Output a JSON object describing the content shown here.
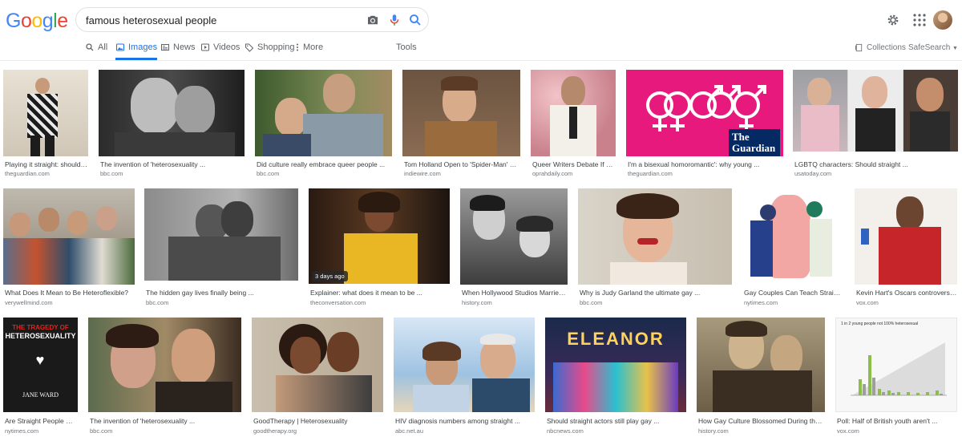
{
  "logo": [
    "G",
    "o",
    "o",
    "g",
    "l",
    "e"
  ],
  "logo_colors": [
    "#4285f4",
    "#ea4335",
    "#fbbc05",
    "#4285f4",
    "#34a853",
    "#ea4335"
  ],
  "search": {
    "query": "famous heterosexual people",
    "icons": [
      "camera-icon",
      "microphone-icon",
      "search-icon"
    ]
  },
  "tabs": [
    {
      "label": "All",
      "icon": "search-icon"
    },
    {
      "label": "Images",
      "icon": "image-icon"
    },
    {
      "label": "News",
      "icon": "news-icon"
    },
    {
      "label": "Videos",
      "icon": "play-icon"
    },
    {
      "label": "Shopping",
      "icon": "tag-icon"
    },
    {
      "label": "More",
      "icon": "dots-icon"
    },
    {
      "label": "Tools"
    }
  ],
  "right": {
    "collections": "Collections",
    "safesearch": "SafeSearch"
  },
  "colors": {
    "accent": "#1a73e8"
  },
  "results": [
    {
      "caption": "Playing it straight: should g...",
      "source": "theguardian.com"
    },
    {
      "caption": "The invention of 'heterosexuality ...",
      "source": "bbc.com"
    },
    {
      "caption": "Did culture really embrace queer people ...",
      "source": "bbc.com"
    },
    {
      "caption": "Tom Holland Open to 'Spider-Man' Co...",
      "source": "indiewire.com"
    },
    {
      "caption": "Queer Writers Debate If Str...",
      "source": "oprahdaily.com"
    },
    {
      "caption": "I'm a bisexual homoromantic': why young ...",
      "source": "theguardian.com",
      "overlay": "The Guardian"
    },
    {
      "caption": "LGBTQ characters: Should straight ...",
      "source": "usatoday.com"
    },
    {
      "caption": "What Does It Mean to Be Heteroflexible?",
      "source": "verywellmind.com"
    },
    {
      "caption": "The hidden gay lives finally being ...",
      "source": "bbc.com"
    },
    {
      "caption": "Explainer: what does it mean to be ...",
      "source": "theconversation.com",
      "badge": "3 days ago"
    },
    {
      "caption": "When Hollywood Studios Married ...",
      "source": "history.com"
    },
    {
      "caption": "Why is Judy Garland the ultimate gay ...",
      "source": "bbc.com"
    },
    {
      "caption": "Gay Couples Can Teach Straight ...",
      "source": "nytimes.com"
    },
    {
      "caption": "Kevin Hart's Oscars controversy f...",
      "source": "vox.com"
    },
    {
      "caption": "Are Straight People OK...",
      "source": "nytimes.com",
      "book": {
        "top": "THE TRAGEDY OF",
        "main": "HETEROSEXUALITY",
        "author": "JANE WARD"
      }
    },
    {
      "caption": "The invention of 'heterosexuality ...",
      "source": "bbc.com"
    },
    {
      "caption": "GoodTherapy | Heterosexuality",
      "source": "goodtherapy.org"
    },
    {
      "caption": "HIV diagnosis numbers among straight ...",
      "source": "abc.net.au"
    },
    {
      "caption": "Should straight actors still play gay ...",
      "source": "nbcnews.com",
      "overlay": "ELEANOR"
    },
    {
      "caption": "How Gay Culture Blossomed During the ...",
      "source": "history.com"
    },
    {
      "caption": "Poll: Half of British youth aren't ...",
      "source": "vox.com",
      "overlay": "1 in 2 young people not 100% heterosexual"
    }
  ]
}
